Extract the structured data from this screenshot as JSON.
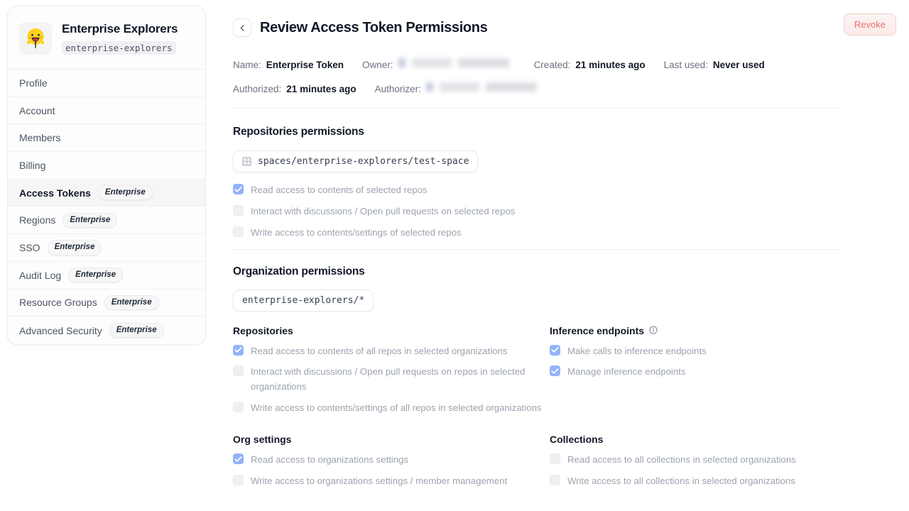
{
  "sidebar": {
    "org": {
      "name": "Enterprise Explorers",
      "slug": "enterprise-explorers",
      "avatar_icon": "hugging-face-emoji"
    },
    "items": [
      {
        "label": "Profile",
        "badge": "",
        "active": false
      },
      {
        "label": "Account",
        "badge": "",
        "active": false
      },
      {
        "label": "Members",
        "badge": "",
        "active": false
      },
      {
        "label": "Billing",
        "badge": "",
        "active": false
      },
      {
        "label": "Access Tokens",
        "badge": "Enterprise",
        "active": true
      },
      {
        "label": "Regions",
        "badge": "Enterprise",
        "active": false
      },
      {
        "label": "SSO",
        "badge": "Enterprise",
        "active": false
      },
      {
        "label": "Audit Log",
        "badge": "Enterprise",
        "active": false
      },
      {
        "label": "Resource Groups",
        "badge": "Enterprise",
        "active": false
      },
      {
        "label": "Advanced Security",
        "badge": "Enterprise",
        "active": false
      }
    ]
  },
  "header": {
    "back_icon": "chevron-left-icon",
    "title": "Review Access Token Permissions",
    "revoke_label": "Revoke"
  },
  "meta": {
    "name_label": "Name:",
    "name_value": "Enterprise Token",
    "owner_label": "Owner:",
    "owner_value_redacted": true,
    "created_label": "Created:",
    "created_value": "21 minutes ago",
    "last_used_label": "Last used:",
    "last_used_value": "Never used",
    "authorized_label": "Authorized:",
    "authorized_value": "21 minutes ago",
    "authorizer_label": "Authorizer:",
    "authorizer_value_redacted": true
  },
  "repositories_permissions": {
    "title": "Repositories permissions",
    "chip": {
      "icon": "spaces-grid-icon",
      "text": "spaces/enterprise-explorers/test-space"
    },
    "permissions": [
      {
        "label": "Read access to contents of selected repos",
        "checked": true
      },
      {
        "label": "Interact with discussions / Open pull requests on selected repos",
        "checked": false
      },
      {
        "label": "Write access to contents/settings of selected repos",
        "checked": false
      }
    ]
  },
  "organization_permissions": {
    "title": "Organization permissions",
    "chip": {
      "text": "enterprise-explorers/*"
    },
    "groups": [
      {
        "heading": "Repositories",
        "info_icon": false,
        "permissions": [
          {
            "label": "Read access to contents of all repos in selected organizations",
            "checked": true
          },
          {
            "label": "Interact with discussions / Open pull requests on repos in selected organizations",
            "checked": false
          },
          {
            "label": "Write access to contents/settings of all repos in selected organizations",
            "checked": false
          }
        ]
      },
      {
        "heading": "Inference endpoints",
        "info_icon": true,
        "permissions": [
          {
            "label": "Make calls to inference endpoints",
            "checked": true
          },
          {
            "label": "Manage inference endpoints",
            "checked": true
          }
        ]
      },
      {
        "heading": "Org settings",
        "info_icon": false,
        "permissions": [
          {
            "label": "Read access to organizations settings",
            "checked": true
          },
          {
            "label": "Write access to organizations settings / member management",
            "checked": false
          }
        ]
      },
      {
        "heading": "Collections",
        "info_icon": false,
        "permissions": [
          {
            "label": "Read access to all collections in selected organizations",
            "checked": false
          },
          {
            "label": "Write access to all collections in selected organizations",
            "checked": false
          }
        ]
      }
    ]
  },
  "colors": {
    "accent_checkbox": "#93b3f8",
    "revoke_text": "#ef6f6f",
    "muted_text": "#9ca3af"
  }
}
